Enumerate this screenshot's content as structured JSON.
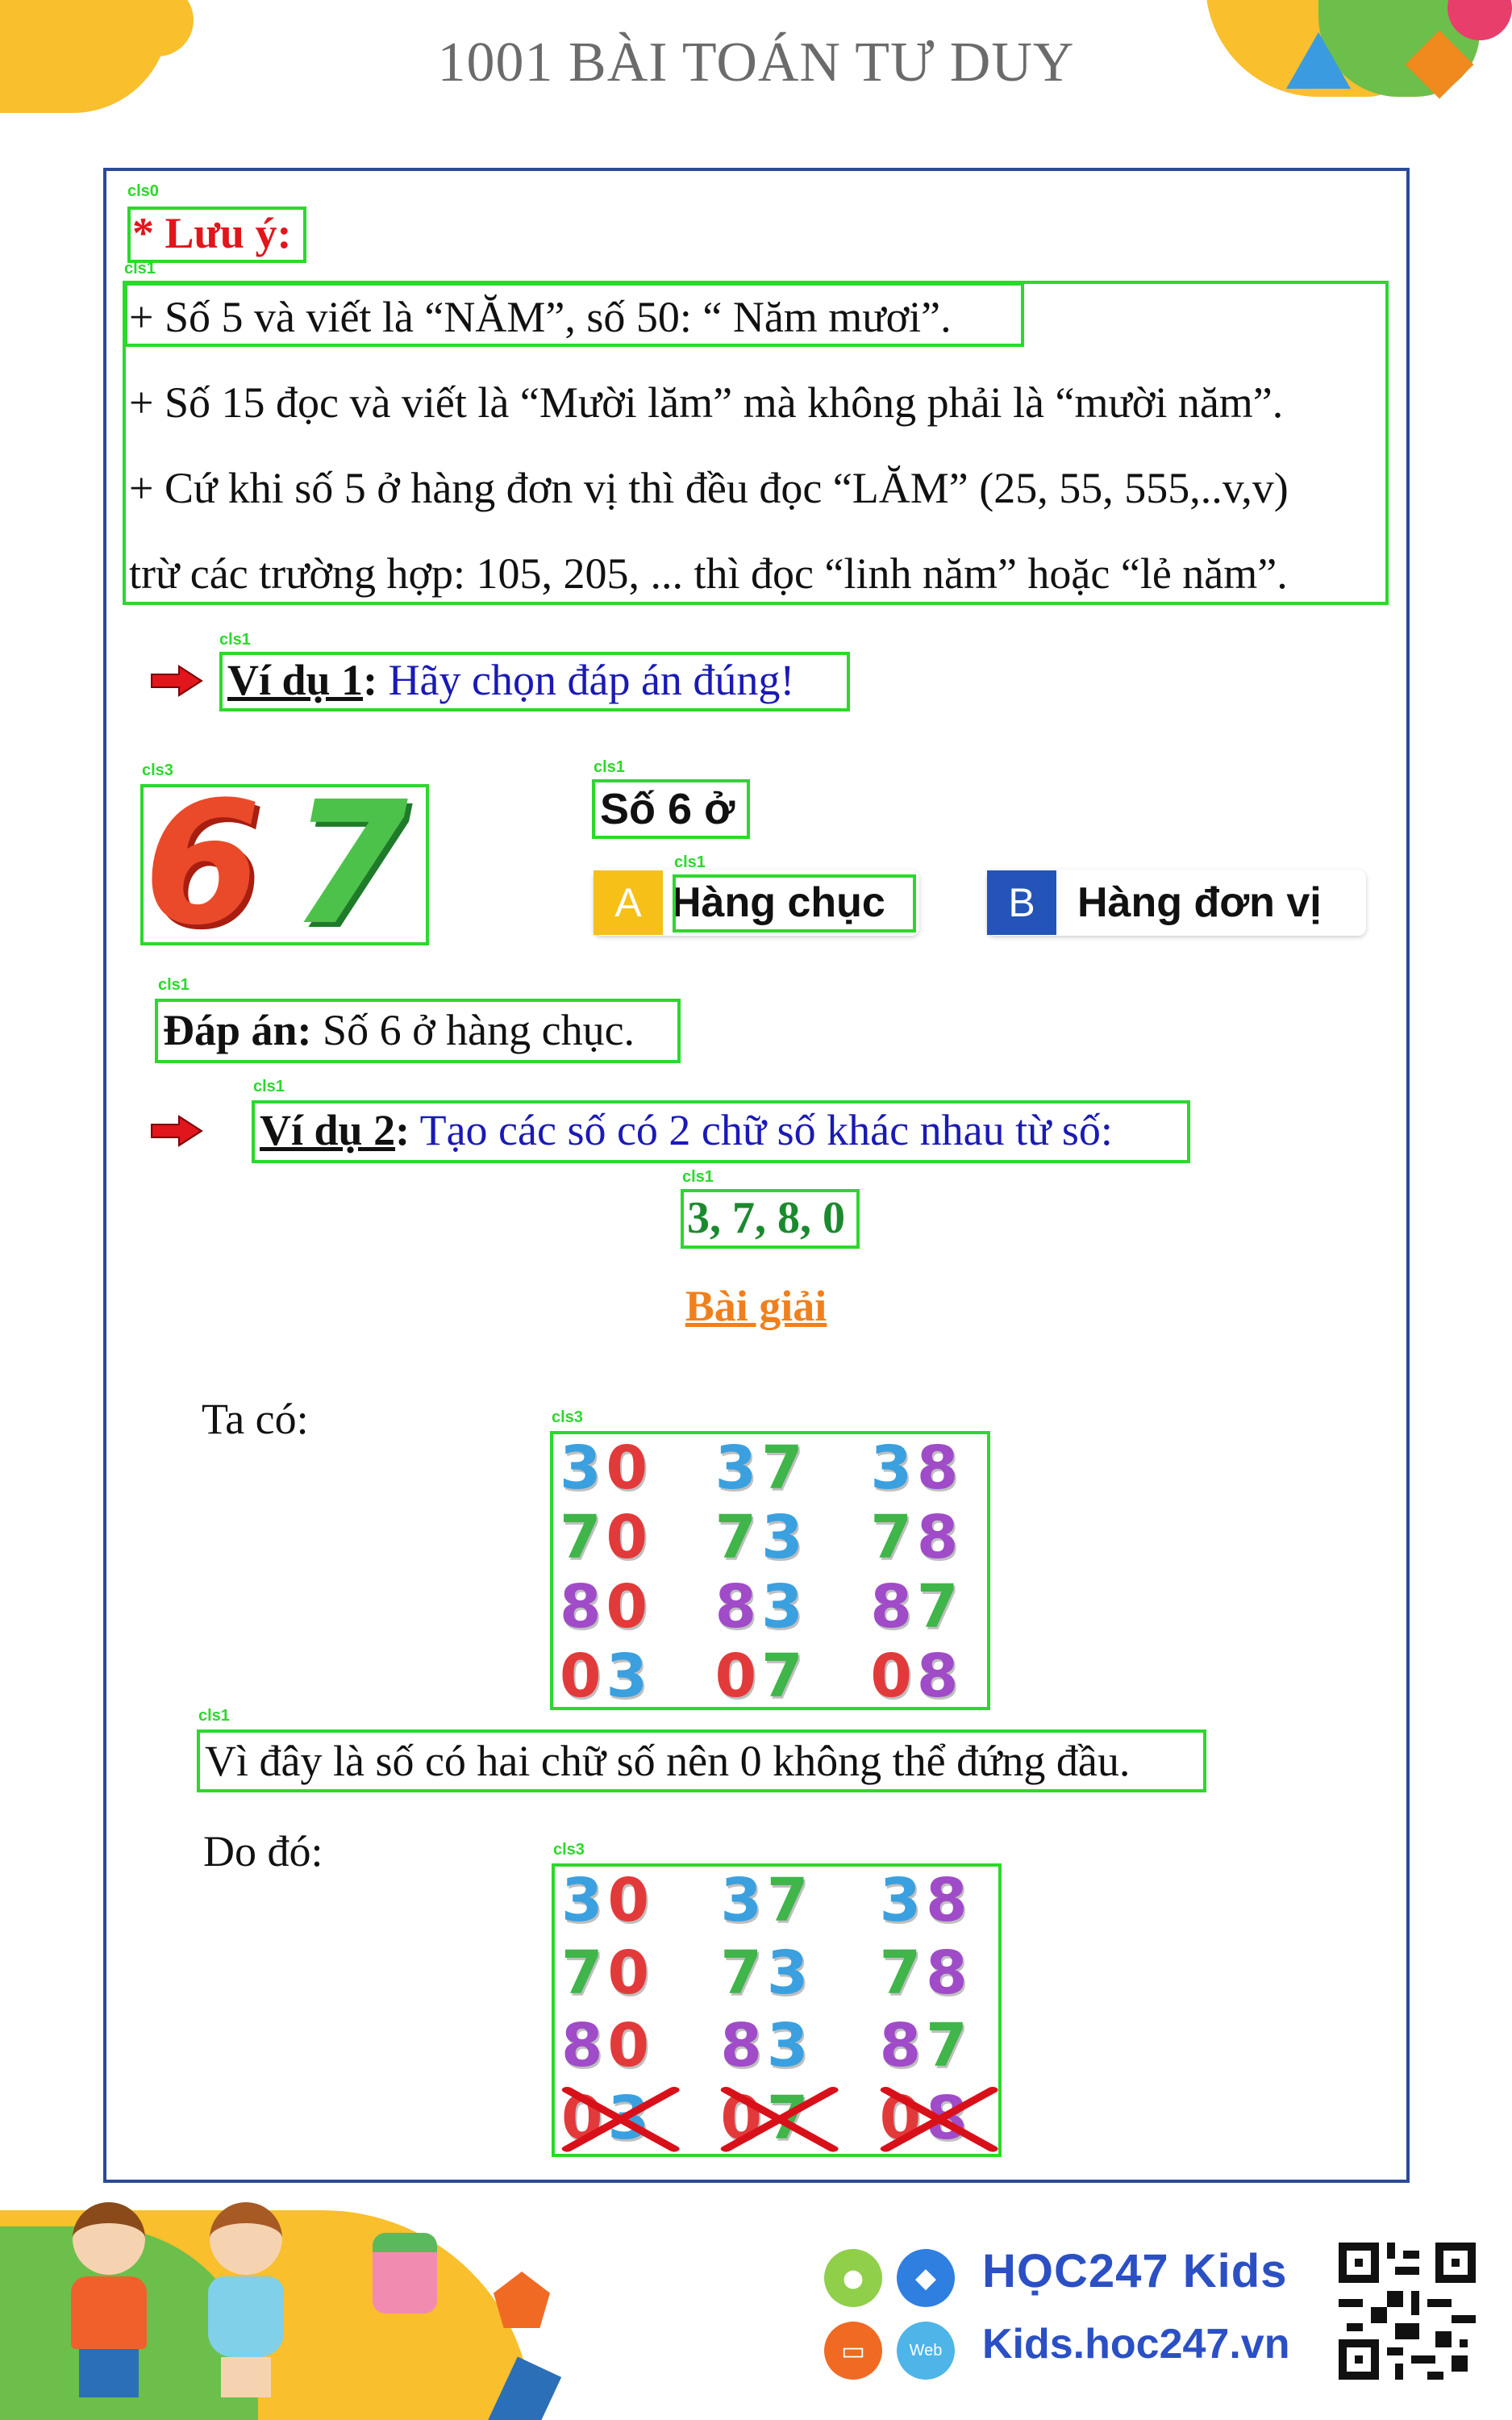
{
  "header": {
    "title": "1001 BÀI TOÁN TƯ DUY"
  },
  "tags": {
    "cls0": "cls0",
    "cls1": "cls1",
    "cls3": "cls3",
    "cls1b": "cls1"
  },
  "note": {
    "title": "* Lưu ý:",
    "lines": [
      "+ Số 5 và viết là “NĂM”, số 50: “ Năm mươi”.",
      "+ Số 15 đọc và viết là “Mười lăm” mà không phải là “mười năm”.",
      "+ Cứ khi số 5 ở hàng đơn vị thì đều đọc “LĂM” (25, 55, 555,..v,v)",
      "trừ các trường hợp: 105, 205, ... thì đọc “linh năm” hoặc “lẻ năm”."
    ]
  },
  "example1": {
    "label": "Ví dụ 1",
    "colon": ":",
    "prompt": " Hãy chọn đáp án đúng!",
    "number_digits": [
      "6",
      "7"
    ],
    "question": "Số 6 ở",
    "options": [
      {
        "letter": "A",
        "text": "Hàng chục"
      },
      {
        "letter": "B",
        "text": "Hàng đơn vị"
      }
    ],
    "answer_label": "Đáp án:",
    "answer_text": " Số 6 ở hàng chục."
  },
  "example2": {
    "label": "Ví dụ 2",
    "colon": ":",
    "prompt": " Tạo các số có 2 chữ số khác nhau từ số:",
    "digits": "3, 7, 8, 0",
    "solution_title": "Bài giải",
    "ta_co": "Ta có:",
    "numbers_all": [
      "30",
      "37",
      "38",
      "70",
      "73",
      "78",
      "80",
      "83",
      "87",
      "03",
      "07",
      "08"
    ],
    "explanation": "Vì đây là số có hai chữ số nên 0 không thể đứng đầu.",
    "do_do": "Do đó:",
    "numbers_final": [
      "30",
      "37",
      "38",
      "70",
      "73",
      "78",
      "80",
      "83",
      "87",
      "03",
      "07",
      "08"
    ],
    "crossed_out": [
      "03",
      "07",
      "08"
    ]
  },
  "footer": {
    "brand": "HỌC247 Kids",
    "website": "Kids.hoc247.vn",
    "web_badge": "Web"
  },
  "colors": {
    "digit_red": "#e23a3a",
    "digit_blue": "#3aa0e0",
    "digit_green": "#3fb54a",
    "digit_purple": "#a04bc8",
    "box_green": "#2cd82c",
    "frame_blue": "#2b4a9a"
  }
}
